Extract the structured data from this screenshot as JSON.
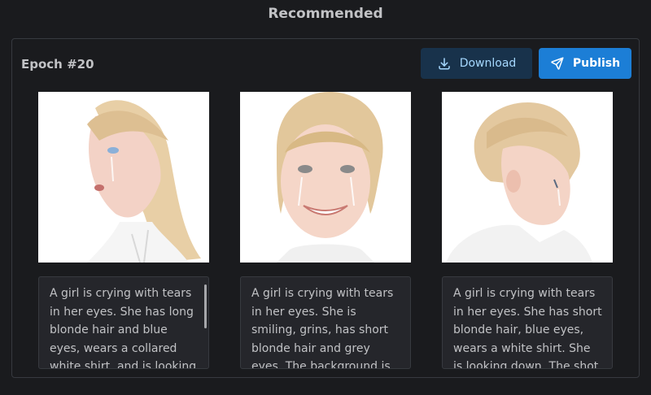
{
  "header": {
    "title": "Recommended"
  },
  "panel": {
    "epoch_title": "Epoch #20",
    "download_label": "Download",
    "publish_label": "Publish",
    "download_icon": "download-icon",
    "publish_icon": "send-icon",
    "colors": {
      "download_bg": "#18324b",
      "download_fg": "#a5d8ff",
      "publish_bg": "#1c7ed6"
    }
  },
  "cards": [
    {
      "image_alt": "Girl with long blonde hair looking up, crying",
      "caption": "A girl is crying with tears in her eyes. She has long blonde hair and blue eyes, wears a collared white shirt, and is looking up. The"
    },
    {
      "image_alt": "Girl with short blonde hair smiling with tears",
      "caption": "A girl is crying with tears in her eyes. She is smiling, grins, has short blonde hair and grey eyes. The background is simple and"
    },
    {
      "image_alt": "Girl with short blonde hair in profile looking down, crying",
      "caption": "A girl is crying with tears in her eyes. She has short blonde hair, blue eyes, wears a white shirt. She is looking down. The shot is"
    }
  ]
}
